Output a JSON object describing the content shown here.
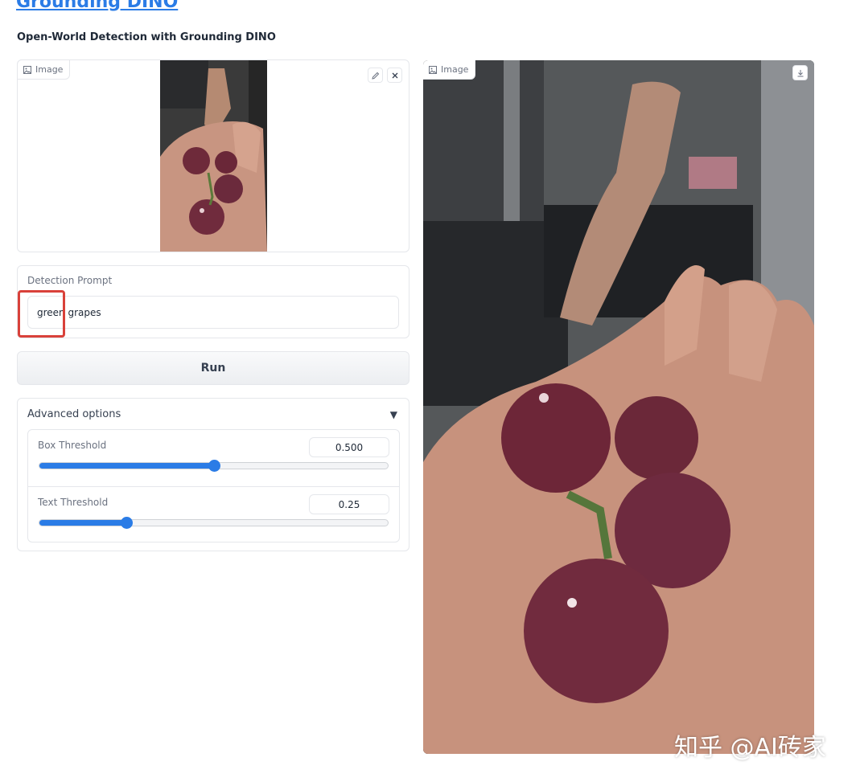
{
  "header": {
    "title": "Grounding DINO",
    "subtitle": "Open-World Detection with Grounding DINO"
  },
  "input_image": {
    "label": "Image",
    "edit_icon": "pencil-icon",
    "clear_icon": "close-icon"
  },
  "prompt": {
    "label": "Detection Prompt",
    "value": "green grapes"
  },
  "run": {
    "label": "Run"
  },
  "advanced": {
    "title": "Advanced options",
    "arrow": "▼",
    "box_threshold": {
      "label": "Box Threshold",
      "value": "0.500",
      "level": 0.5
    },
    "text_threshold": {
      "label": "Text Threshold",
      "value": "0.25",
      "level": 0.25
    }
  },
  "output_image": {
    "label": "Image",
    "download_icon": "download-icon"
  },
  "watermark": "知乎 @AI砖家",
  "colors": {
    "accent": "#2b7ce6",
    "highlight": "#d9413a"
  }
}
